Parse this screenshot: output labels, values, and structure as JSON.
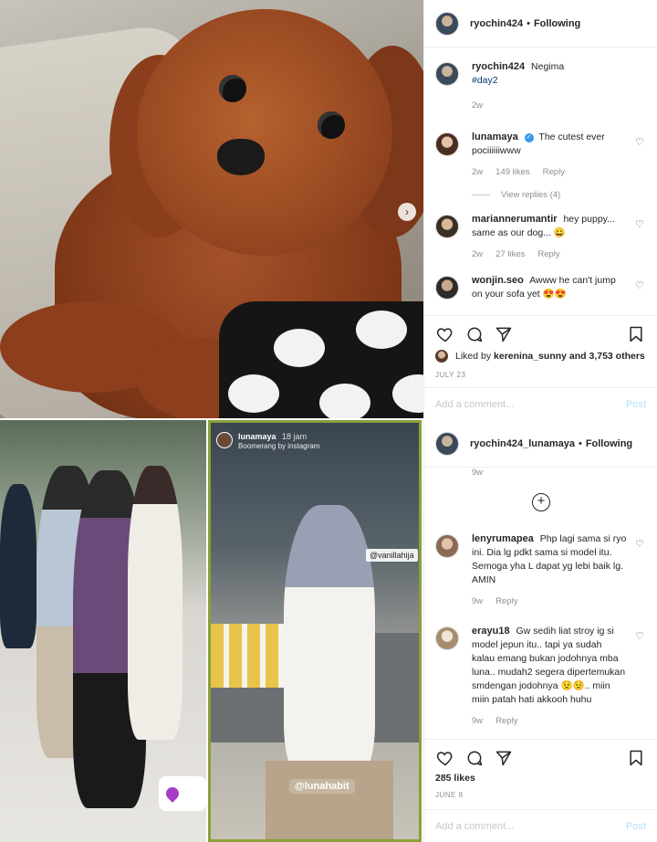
{
  "post1": {
    "header": {
      "username": "ryochin424",
      "follow_label": "Following"
    },
    "caption": {
      "username": "ryochin424",
      "text": "Negima",
      "hashtag": "#day2",
      "age": "2w"
    },
    "comments": [
      {
        "username": "lunamaya",
        "verified": true,
        "text": "The cutest ever pociiiiiiwww",
        "age": "2w",
        "likes": "149 likes",
        "reply": "Reply"
      },
      {
        "username": "mariannerumantir",
        "text": "hey puppy... same as our dog... 😀",
        "age": "2w",
        "likes": "27 likes",
        "reply": "Reply"
      },
      {
        "username": "wonjin.seo",
        "text": "Awww he can't jump on your sofa yet 😍😍"
      }
    ],
    "view_replies": "View replies (4)",
    "liked_by": {
      "prefix": "Liked by",
      "user": "kerenina_sunny",
      "suffix": "and 3,753 others"
    },
    "date": "JULY 23",
    "add_comment_placeholder": "Add a comment...",
    "post_label": "Post"
  },
  "post2": {
    "header": {
      "username": "ryochin424_lunamaya",
      "follow_label": "Following"
    },
    "top_age": "9w",
    "comments": [
      {
        "username": "lenyrumapea",
        "text": "Php lagi sama si ryo ini. Dia lg pdkt sama si model itu. Semoga yha L dapat yg lebi baik lg. AMIN",
        "age": "9w",
        "reply": "Reply"
      },
      {
        "username": "erayu18",
        "text": "Gw sedih liat stroy ig si model jepun itu.. tapi ya sudah kalau emang bukan jodohnya mba luna.. mudah2 segera dipertemukan smdengan jodohnya 😟😟.. miin miin patah hati akkooh huhu",
        "age": "9w",
        "reply": "Reply"
      }
    ],
    "likes": "285 likes",
    "date": "JUNE 8",
    "add_comment_placeholder": "Add a comment...",
    "post_label": "Post",
    "story": {
      "username": "lunamaya",
      "time": "18 jam",
      "subtitle": "Boomerang by instagram",
      "tag1": "@vanillahija",
      "tag2": "@lunahabit"
    }
  }
}
